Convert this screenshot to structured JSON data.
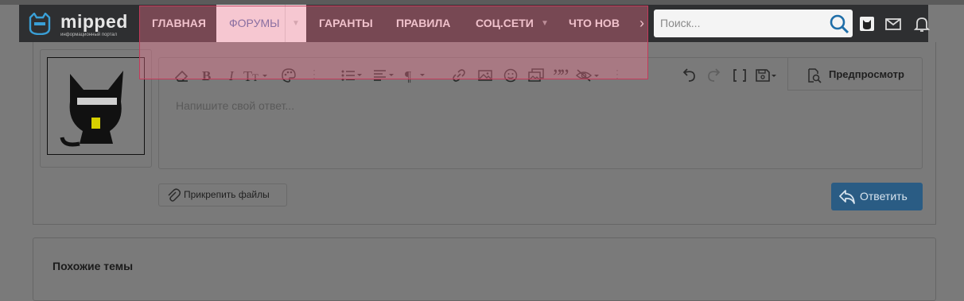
{
  "brand": {
    "name": "mipped",
    "tagline": "информационный портал"
  },
  "nav": {
    "items": [
      {
        "label": "ГЛАВНАЯ"
      },
      {
        "label": "ФОРУМЫ",
        "active": true
      },
      {
        "label": "ГАРАНТЫ"
      },
      {
        "label": "ПРАВИЛА"
      },
      {
        "label": "СОЦ.СЕТИ"
      },
      {
        "label": "ЧТО НОВ"
      }
    ]
  },
  "search": {
    "placeholder": "Поиск..."
  },
  "editor": {
    "placeholder": "Напишите свой ответ...",
    "preview_label": "Предпросмотр",
    "toolbar_icons": [
      "eraser-icon",
      "bold-icon",
      "italic-icon",
      "font-size-icon",
      "palette-icon",
      "more-icon",
      "list-icon",
      "align-icon",
      "paragraph-icon",
      "link-icon",
      "image-icon",
      "smiley-icon",
      "media-icon",
      "quote-icon",
      "spoiler-icon",
      "more-icon",
      "undo-icon",
      "redo-icon",
      "bbcode-icon",
      "save-draft-icon",
      "preview-icon"
    ]
  },
  "attach": {
    "label": "Прикрепить файлы"
  },
  "reply": {
    "label": "Ответить"
  },
  "similar": {
    "title": "Похожие темы"
  },
  "colors": {
    "nav_bg": "#2e2f31",
    "active_tab_text": "#4a6aa8",
    "reply_button": "#2a5c84",
    "highlight": "#ff7896"
  }
}
